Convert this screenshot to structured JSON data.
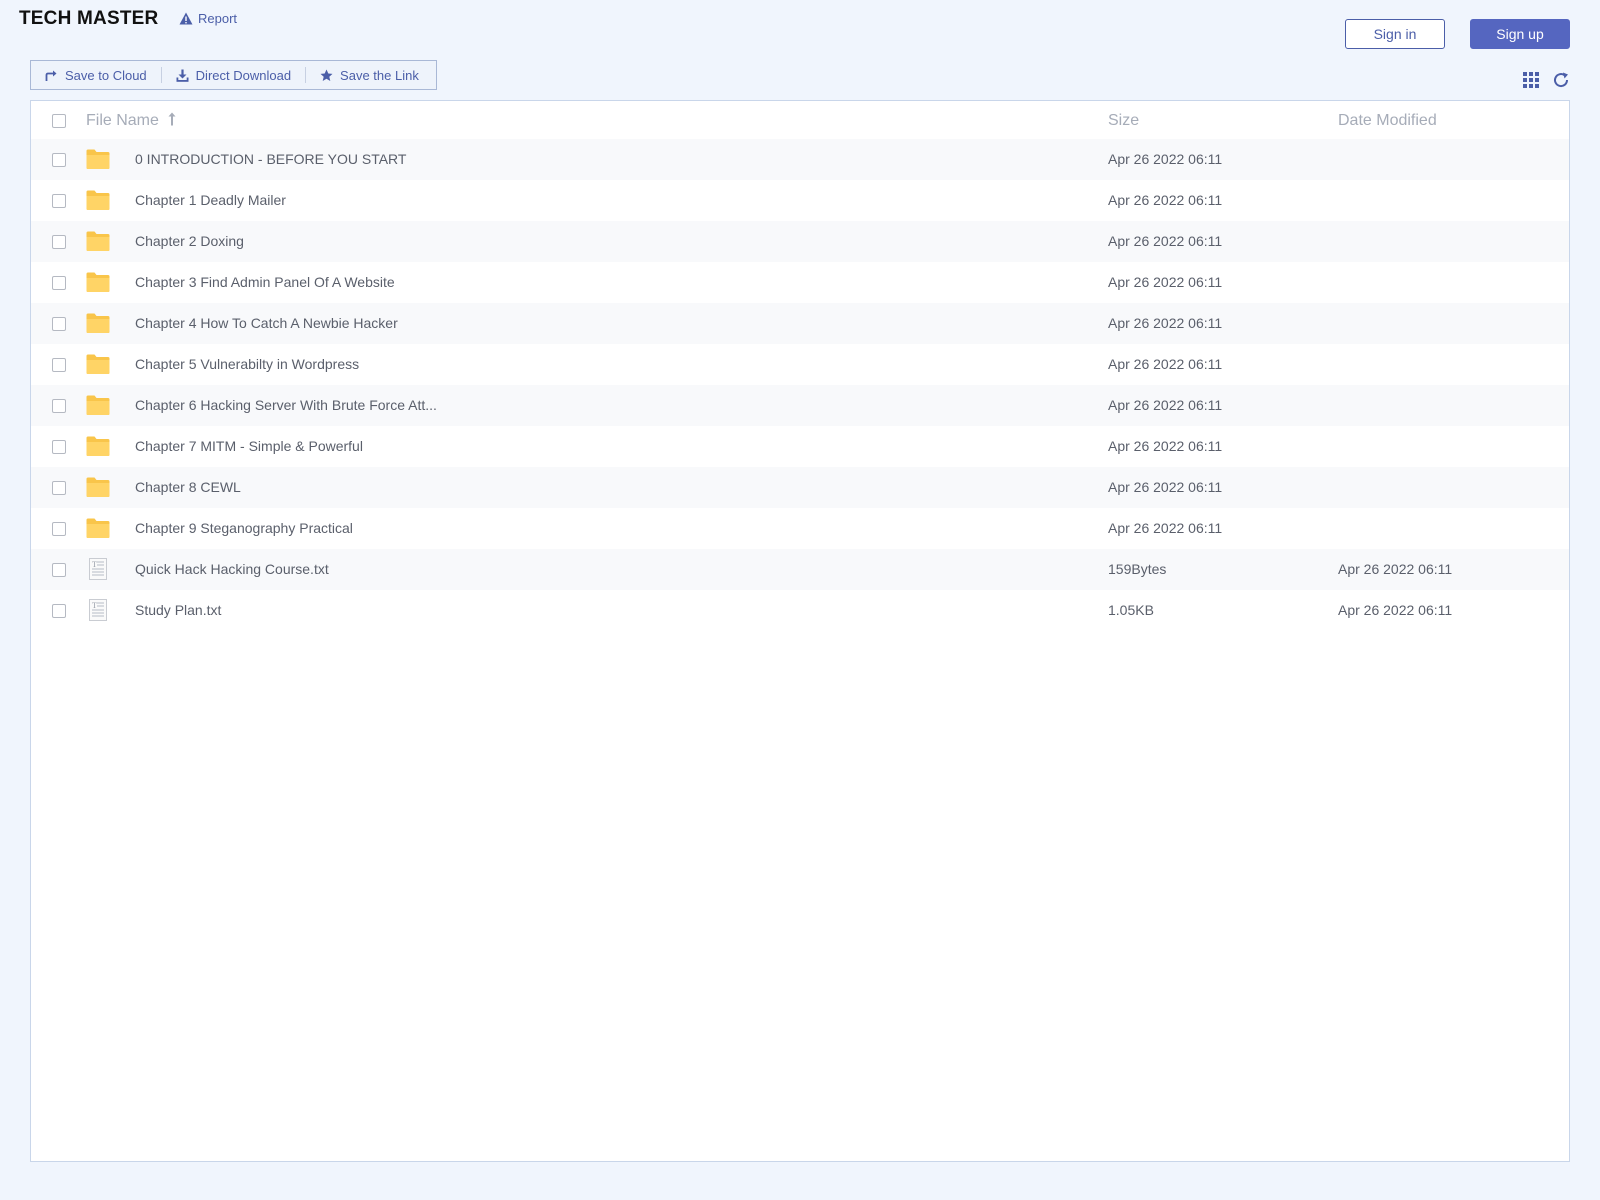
{
  "header": {
    "site_title": "TECH MASTER",
    "report_label": "Report",
    "signin_label": "Sign in",
    "signup_label": "Sign up"
  },
  "toolbar": {
    "save_cloud": "Save to Cloud",
    "direct_download": "Direct Download",
    "save_link": "Save the Link"
  },
  "table": {
    "col_name": "File Name",
    "col_size": "Size",
    "col_date": "Date Modified",
    "rows": [
      {
        "name": "0 INTRODUCTION - BEFORE YOU START",
        "size": "Apr 26 2022 06:11",
        "date": "",
        "icon": "folder-icon"
      },
      {
        "name": "Chapter 1 Deadly Mailer",
        "size": "Apr 26 2022 06:11",
        "date": "",
        "icon": "folder-icon"
      },
      {
        "name": "Chapter 2 Doxing",
        "size": "Apr 26 2022 06:11",
        "date": "",
        "icon": "folder-icon"
      },
      {
        "name": "Chapter 3 Find Admin Panel Of A Website",
        "size": "Apr 26 2022 06:11",
        "date": "",
        "icon": "folder-icon"
      },
      {
        "name": "Chapter 4 How To Catch A Newbie Hacker",
        "size": "Apr 26 2022 06:11",
        "date": "",
        "icon": "folder-icon"
      },
      {
        "name": "Chapter 5 Vulnerabilty in Wordpress",
        "size": "Apr 26 2022 06:11",
        "date": "",
        "icon": "folder-icon"
      },
      {
        "name": "Chapter 6 Hacking Server With Brute Force Att...",
        "size": "Apr 26 2022 06:11",
        "date": "",
        "icon": "folder-icon"
      },
      {
        "name": "Chapter 7 MITM - Simple & Powerful",
        "size": "Apr 26 2022 06:11",
        "date": "",
        "icon": "folder-icon"
      },
      {
        "name": "Chapter 8 CEWL",
        "size": "Apr 26 2022 06:11",
        "date": "",
        "icon": "folder-icon"
      },
      {
        "name": "Chapter 9 Steganography Practical",
        "size": "Apr 26 2022 06:11",
        "date": "",
        "icon": "folder-icon"
      },
      {
        "name": "Quick Hack Hacking Course.txt",
        "size": "159Bytes",
        "date": "Apr 26 2022 06:11",
        "icon": "text-file-icon"
      },
      {
        "name": "Study Plan.txt",
        "size": "1.05KB",
        "date": "Apr 26 2022 06:11",
        "icon": "text-file-icon"
      }
    ]
  },
  "colors": {
    "accent": "#5566c0",
    "link": "#4b5ea8",
    "folder": "#ffcf5c",
    "background": "#f0f5fd"
  }
}
